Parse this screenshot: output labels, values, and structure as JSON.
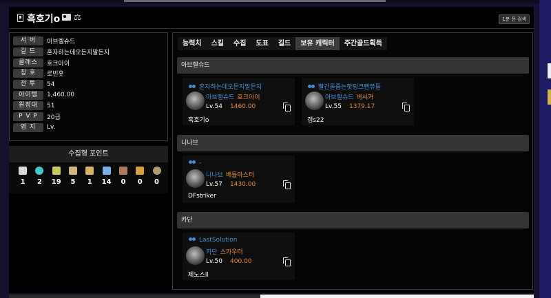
{
  "header": {
    "title": "흑호기o",
    "search_button": "1분 전 검색"
  },
  "info": [
    {
      "label": "서 버",
      "value": "아브렐슈드"
    },
    {
      "label": "길 드",
      "value": "혼자하는데오든지말든지"
    },
    {
      "label": "클래스",
      "value": "호크아이"
    },
    {
      "label": "칭 호",
      "value": "로빈훗"
    },
    {
      "label": "전 투",
      "value": "54"
    },
    {
      "label": "아이템",
      "value": "1,460.00"
    },
    {
      "label": "원정대",
      "value": "51"
    },
    {
      "label": "P V P",
      "value": "20급"
    },
    {
      "label": "영 지",
      "value": "Lv."
    }
  ],
  "collect": {
    "title": "수집형 포인트",
    "items": [
      {
        "icon": "mokoko-seed-icon",
        "color": "#d8d8d8",
        "count": "1"
      },
      {
        "icon": "island-heart-icon",
        "color": "#3fc9c9",
        "count": "2"
      },
      {
        "icon": "giant-heart-icon",
        "color": "#c8c85a",
        "count": "19"
      },
      {
        "icon": "art-icon",
        "color": "#d0b47a",
        "count": "5"
      },
      {
        "icon": "ignea-token-icon",
        "color": "#d8b060",
        "count": "1"
      },
      {
        "icon": "orpheus-star-icon",
        "color": "#7ab0e8",
        "count": "14"
      },
      {
        "icon": "world-tree-leaf-icon",
        "color": "#b07a5a",
        "count": "0"
      },
      {
        "icon": "sea-bounty-icon",
        "color": "#d8a040",
        "count": "0"
      },
      {
        "icon": "omnium-star-icon",
        "color": "#b09a70",
        "count": "0"
      }
    ]
  },
  "tabs": [
    "능력치",
    "스킬",
    "수집",
    "도표",
    "길드",
    "보유 캐릭터",
    "주간골드획득"
  ],
  "active_tab": "보유 캐릭터",
  "servers": [
    {
      "name": "아브렐슈드",
      "characters": [
        {
          "guild": "혼자하는데오든지말든지",
          "server": "아브렐슈드",
          "class": "호크아이",
          "level": "Lv.54",
          "ilvl": "1460.00",
          "name": "흑호기o"
        },
        {
          "guild": "빨간돌줍는핫핑크빤쮸들",
          "server": "아브렐슈드",
          "class": "버서커",
          "level": "Lv.55",
          "ilvl": "1379.17",
          "name": "갱s22"
        }
      ]
    },
    {
      "name": "니나브",
      "characters": [
        {
          "guild": "-",
          "server": "니나브",
          "class": "배틀마스터",
          "level": "Lv.57",
          "ilvl": "1430.00",
          "name": "DFstriker"
        }
      ]
    },
    {
      "name": "카단",
      "characters": [
        {
          "guild": "LastSolution",
          "server": "카단",
          "class": "스카우터",
          "level": "Lv.50",
          "ilvl": "400.00",
          "name": "제노스ll"
        }
      ]
    }
  ]
}
